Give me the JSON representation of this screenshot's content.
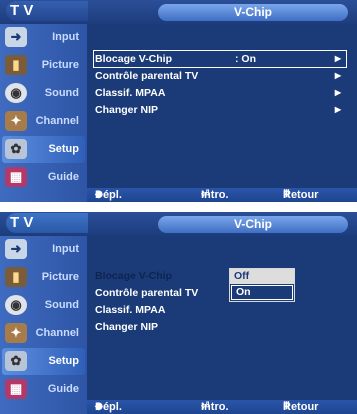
{
  "menu_category": "T V",
  "screen_title": "V-Chip",
  "sidebar": {
    "items": [
      {
        "label": "Input",
        "icon": "input-icon"
      },
      {
        "label": "Picture",
        "icon": "picture-icon"
      },
      {
        "label": "Sound",
        "icon": "sound-icon"
      },
      {
        "label": "Channel",
        "icon": "channel-icon"
      },
      {
        "label": "Setup",
        "icon": "setup-icon"
      },
      {
        "label": "Guide",
        "icon": "guide-icon"
      }
    ]
  },
  "panel1": {
    "rows": [
      {
        "label": "Blocage V-Chip",
        "value": ": On",
        "arrow": "▶"
      },
      {
        "label": "Contrôle parental TV",
        "arrow": "▶"
      },
      {
        "label": "Classif. MPAA",
        "arrow": "▶"
      },
      {
        "label": "Changer NIP",
        "arrow": "▶"
      }
    ]
  },
  "panel2": {
    "rows": [
      {
        "label": "Blocage V-Chip",
        "value": ":"
      },
      {
        "label": "Contrôle parental TV"
      },
      {
        "label": "Classif. MPAA"
      },
      {
        "label": "Changer NIP"
      }
    ],
    "dropdown": {
      "options": [
        "Off",
        "On"
      ],
      "highlighted": "Off",
      "selected": "On"
    }
  },
  "footer": {
    "move_icon": "◆",
    "move_label": "Dépl.",
    "enter_icon": "⏎",
    "enter_label": "Intro.",
    "return_icon": "Ⅲ",
    "return_label": "Retour"
  },
  "colors": {
    "background": "#1a3a78",
    "title_pill": "#5a8ad8",
    "text": "#ffffff"
  }
}
